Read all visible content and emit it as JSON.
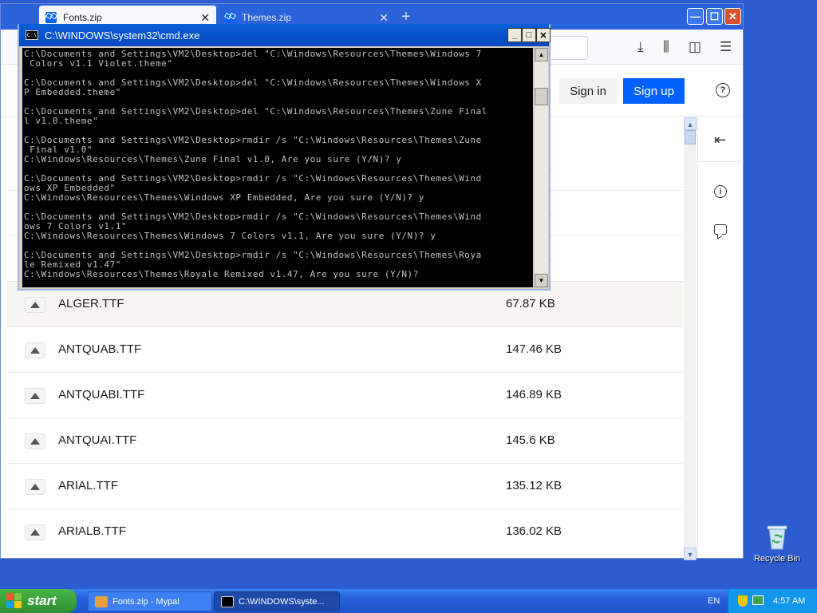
{
  "browser": {
    "tabs": [
      {
        "label": "Fonts.zip",
        "close": "✕"
      },
      {
        "label": "Themes.zip",
        "close": "✕"
      }
    ],
    "new_tab": "+",
    "window_controls": {
      "min": "—",
      "max": "☐",
      "close": "✕"
    },
    "toolbar": {
      "download": "⤓",
      "library": "⫼",
      "sidebar": "◫",
      "menu": "☰"
    }
  },
  "header": {
    "signin": "Sign in",
    "signup": "Sign up",
    "help": "?"
  },
  "files": [
    {
      "name": "ALGER.TTF",
      "size": "67.87 KB"
    },
    {
      "name": "ANTQUAB.TTF",
      "size": "147.46 KB"
    },
    {
      "name": "ANTQUABI.TTF",
      "size": "146.89 KB"
    },
    {
      "name": "ANTQUAI.TTF",
      "size": "145.6 KB"
    },
    {
      "name": "ARIAL.TTF",
      "size": "135.12 KB"
    },
    {
      "name": "ARIALB.TTF",
      "size": "136.02 KB"
    }
  ],
  "hidden_sizes": [
    "B",
    "B",
    "B"
  ],
  "rail": {
    "collapse": "⇤",
    "info": "i"
  },
  "cmd": {
    "title": "C:\\WINDOWS\\system32\\cmd.exe",
    "icon_text": "C:\\",
    "controls": {
      "min": "_",
      "max": "□",
      "close": "✕"
    },
    "output": "C:\\Documents and Settings\\VM2\\Desktop>del \"C:\\Windows\\Resources\\Themes\\Windows 7\n Colors v1.1 Violet.theme\"\n\nC:\\Documents and Settings\\VM2\\Desktop>del \"C:\\Windows\\Resources\\Themes\\Windows X\nP Embedded.theme\"\n\nC:\\Documents and Settings\\VM2\\Desktop>del \"C:\\Windows\\Resources\\Themes\\Zune Final\nl v1.0.theme\"\n\nC:\\Documents and Settings\\VM2\\Desktop>rmdir /s \"C:\\Windows\\Resources\\Themes\\Zune\n Final v1.0\"\nC:\\Windows\\Resources\\Themes\\Zune Final v1.0, Are you sure (Y/N)? y\n\nC:\\Documents and Settings\\VM2\\Desktop>rmdir /s \"C:\\Windows\\Resources\\Themes\\Wind\nows XP Embedded\"\nC:\\Windows\\Resources\\Themes\\Windows XP Embedded, Are you sure (Y/N)? y\n\nC:\\Documents and Settings\\VM2\\Desktop>rmdir /s \"C:\\Windows\\Resources\\Themes\\Wind\nows 7 Colors v1.1\"\nC:\\Windows\\Resources\\Themes\\Windows 7 Colors v1.1, Are you sure (Y/N)? y\n\nC:\\Documents and Settings\\VM2\\Desktop>rmdir /s \"C:\\Windows\\Resources\\Themes\\Roya\nle Remixed v1.47\"\nC:\\Windows\\Resources\\Themes\\Royale Remixed v1.47, Are you sure (Y/N)?",
    "scroll_up": "▲",
    "scroll_down": "▼"
  },
  "desktop": {
    "recycle_bin": "Recycle Bin"
  },
  "taskbar": {
    "start": "start",
    "tasks": [
      {
        "label": "Fonts.zip - Mypal"
      },
      {
        "label": "C:\\WINDOWS\\syste..."
      }
    ],
    "language": "EN",
    "clock": "4:57 AM"
  },
  "colors": {
    "desktop": "#2c5ccf",
    "accent": "#0061fe",
    "xp_taskbar": "#245edb",
    "start_green": "#3a9e3a"
  }
}
